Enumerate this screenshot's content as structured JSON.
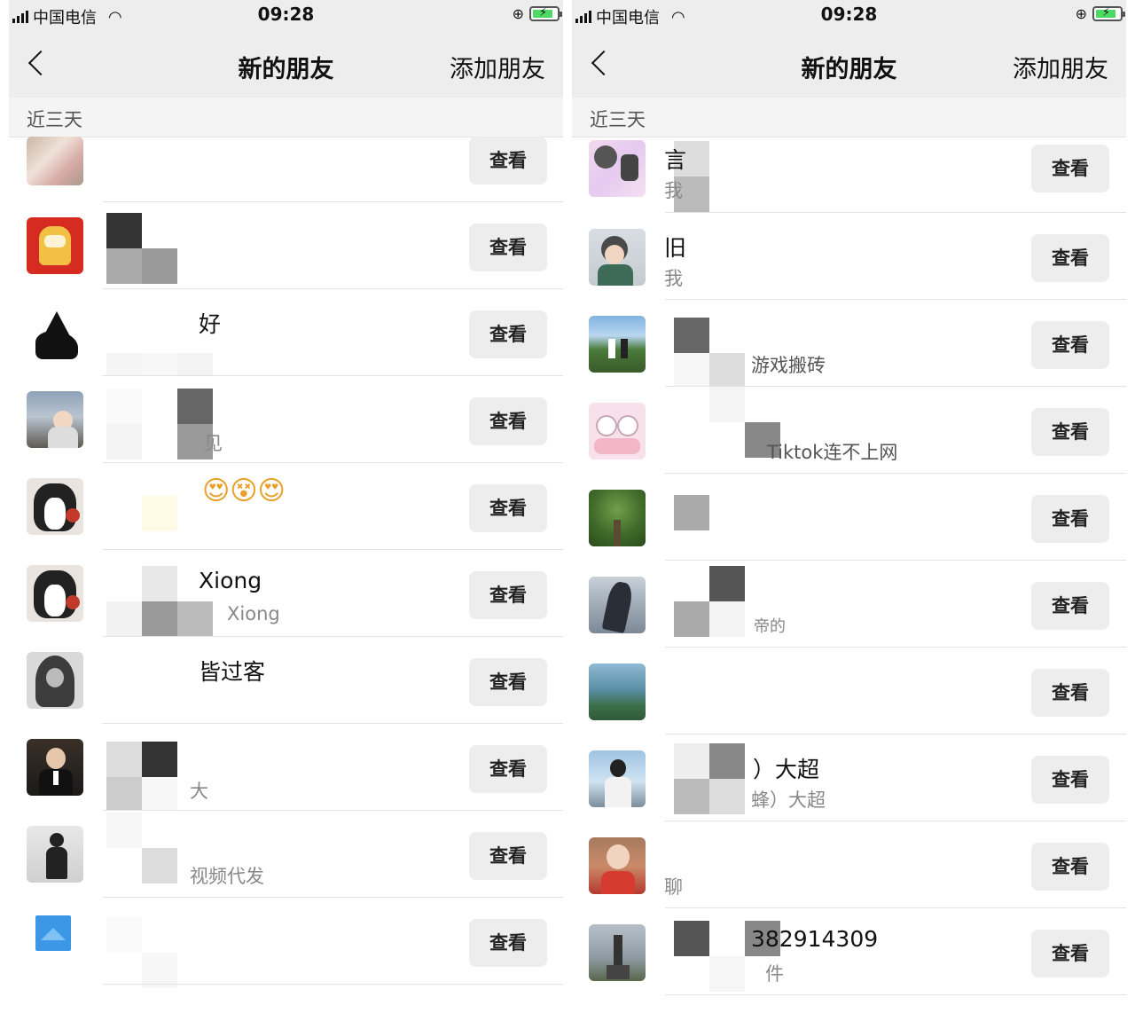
{
  "status_bar": {
    "carrier": "中国电信",
    "time": "09:28"
  },
  "nav": {
    "title": "新的朋友",
    "add_friend": "添加朋友"
  },
  "section_header": "近三天",
  "view_button": "查看",
  "left_list": [
    {
      "name": "",
      "sub": ""
    },
    {
      "name": "",
      "sub": ""
    },
    {
      "name": "好",
      "sub": ""
    },
    {
      "name": "",
      "sub": "见"
    },
    {
      "name": "😍😵😍",
      "sub": ""
    },
    {
      "name": "Xiong",
      "sub": "Xiong"
    },
    {
      "name": "皆过客",
      "sub": ""
    },
    {
      "name": "",
      "sub": "大"
    },
    {
      "name": "",
      "sub": "视频代发"
    },
    {
      "name": "",
      "sub": ""
    }
  ],
  "right_list": [
    {
      "name": "言",
      "sub": "我"
    },
    {
      "name": "旧",
      "sub": "我"
    },
    {
      "name": "",
      "sub": "游戏搬砖"
    },
    {
      "name": "",
      "sub": "Tiktok连不上网"
    },
    {
      "name": "",
      "sub": ""
    },
    {
      "name": "",
      "sub": "帝的"
    },
    {
      "name": "",
      "sub": ""
    },
    {
      "name": "）大超",
      "sub": "蜂）大超"
    },
    {
      "name": "",
      "sub": "聊"
    },
    {
      "name": "382914309",
      "sub": "件"
    }
  ],
  "colors": {
    "nav_bg": "#ededed",
    "button_bg": "#ededed",
    "battery_green": "#4cd964"
  },
  "icons": [
    "signal-icon",
    "wifi-icon",
    "lock-rotation-icon",
    "battery-icon",
    "back-chevron-icon"
  ]
}
